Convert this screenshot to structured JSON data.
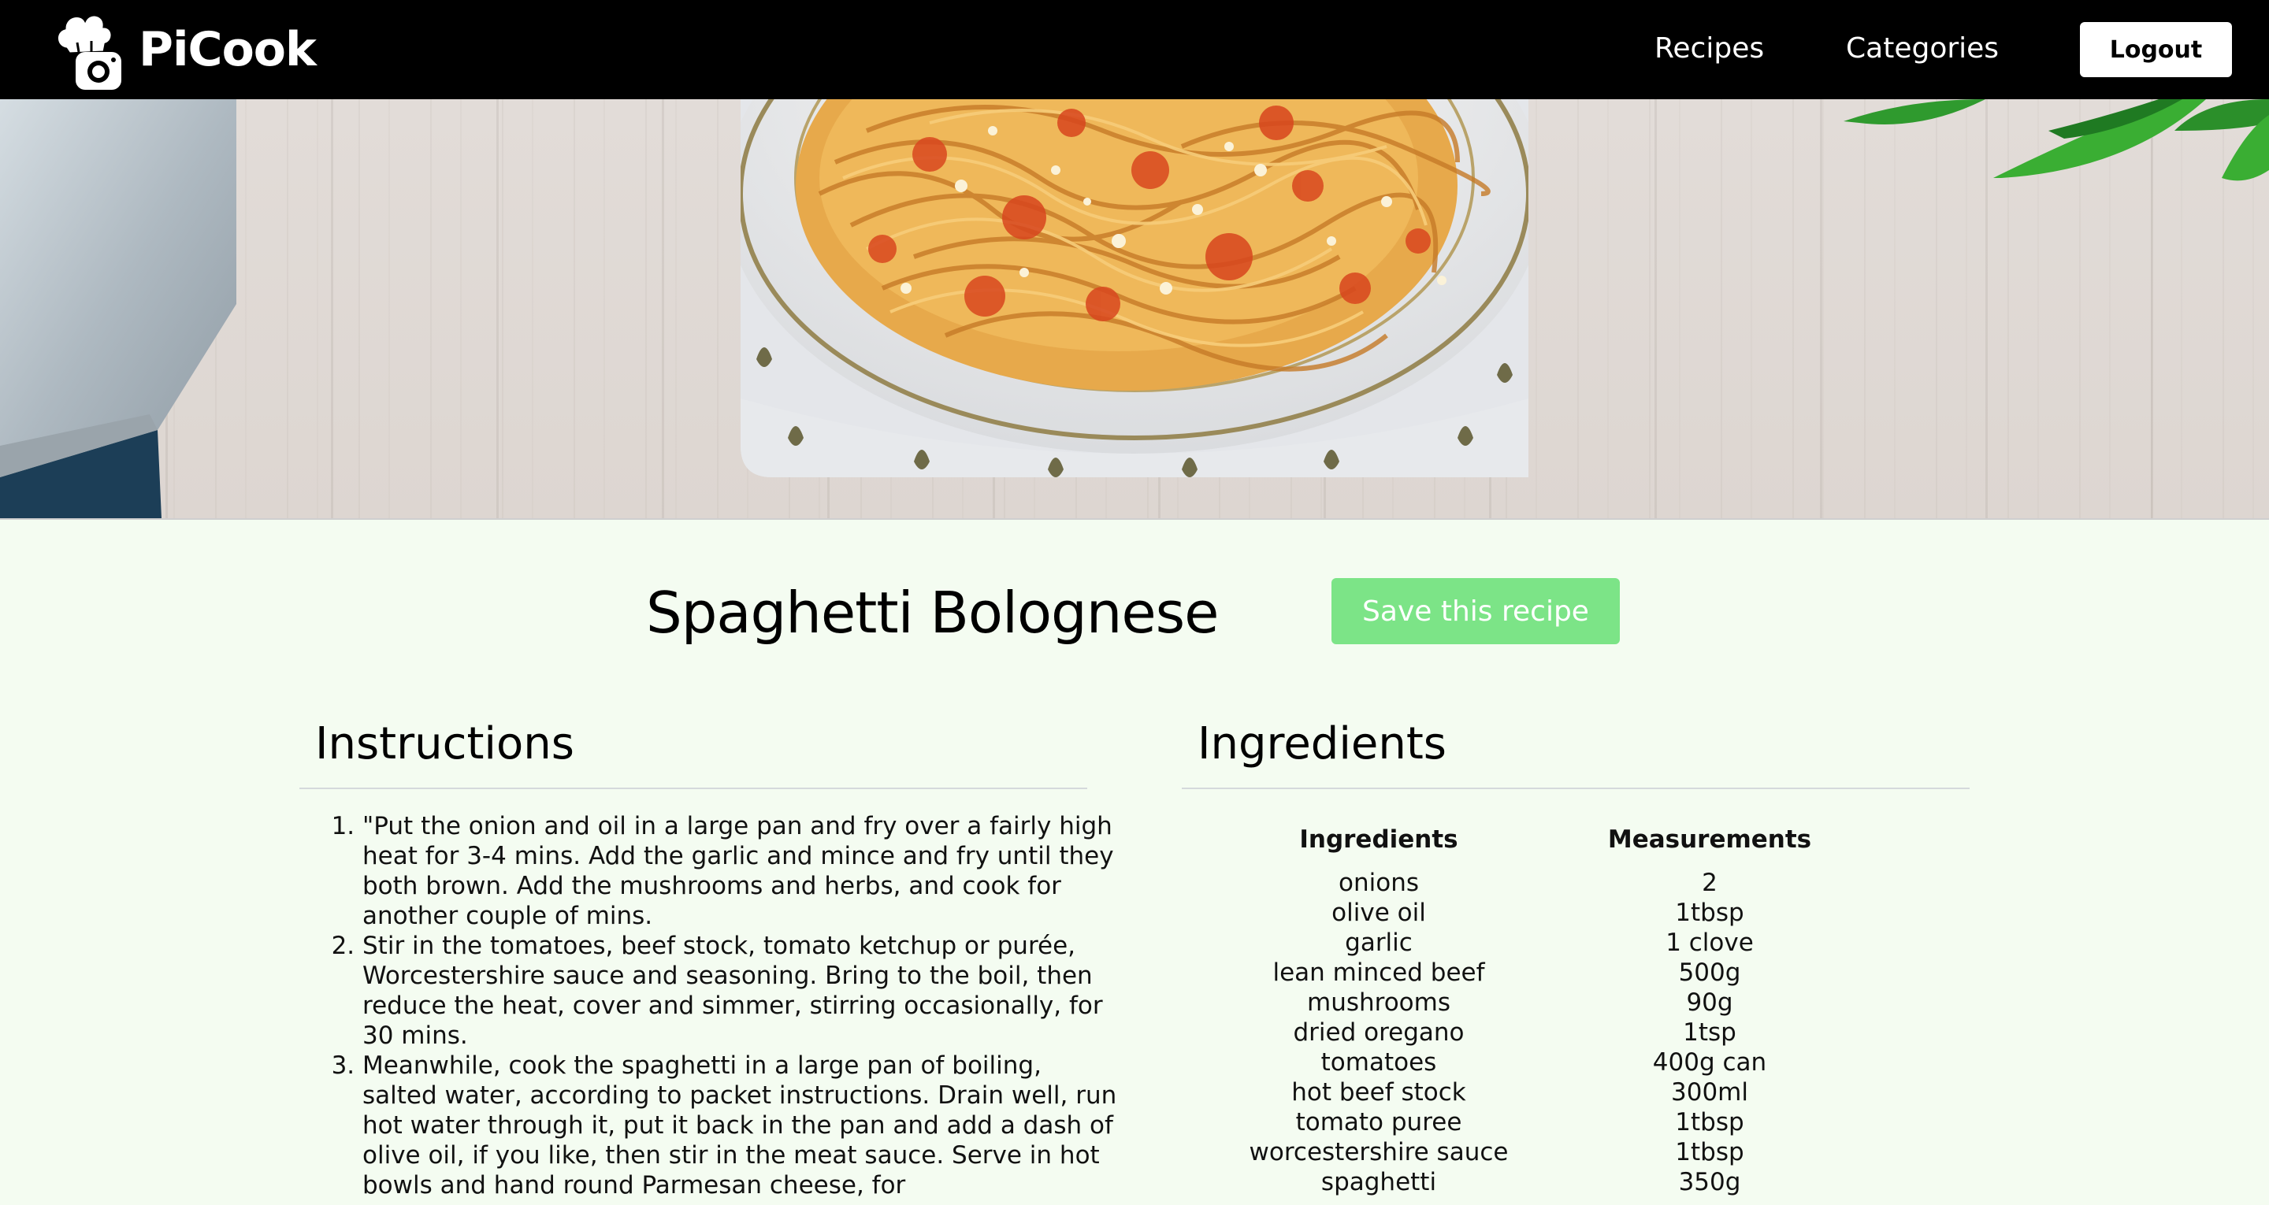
{
  "navbar": {
    "brand": "PiCook",
    "links": [
      "Recipes",
      "Categories"
    ],
    "logout_label": "Logout"
  },
  "recipe": {
    "title": "Spaghetti Bolognese",
    "save_label": "Save this recipe"
  },
  "instructions": {
    "heading": "Instructions",
    "steps": [
      "\"Put the onion and oil in a large pan and fry over a fairly high heat for 3-4 mins. Add the garlic and mince and fry until they both brown. Add the mushrooms and herbs, and cook for another couple of mins.",
      "Stir in the tomatoes, beef stock, tomato ketchup or purée, Worcestershire sauce and seasoning. Bring to the boil, then reduce the heat, cover and simmer, stirring occasionally, for 30 mins.",
      "Meanwhile, cook the spaghetti in a large pan of boiling, salted water, according to packet instructions. Drain well, run hot water through it, put it back in the pan and add a dash of olive oil, if you like, then stir in the meat sauce. Serve in hot bowls and hand round Parmesan cheese, for"
    ]
  },
  "ingredients": {
    "heading": "Ingredients",
    "columns": [
      "Ingredients",
      "Measurements"
    ],
    "rows": [
      [
        "onions",
        "2"
      ],
      [
        "olive oil",
        "1tbsp"
      ],
      [
        "garlic",
        "1 clove"
      ],
      [
        "lean minced beef",
        "500g"
      ],
      [
        "mushrooms",
        "90g"
      ],
      [
        "dried oregano",
        "1tsp"
      ],
      [
        "tomatoes",
        "400g can"
      ],
      [
        "hot beef stock",
        "300ml"
      ],
      [
        "tomato puree",
        "1tbsp"
      ],
      [
        "worcestershire sauce",
        "1tbsp"
      ],
      [
        "spaghetti",
        "350g"
      ]
    ]
  },
  "colors": {
    "navbar_bg": "#000000",
    "page_bg": "#f4fcf1",
    "save_button": "#7ce487"
  },
  "icons": {
    "logo": "chef-hat-camera-icon"
  }
}
